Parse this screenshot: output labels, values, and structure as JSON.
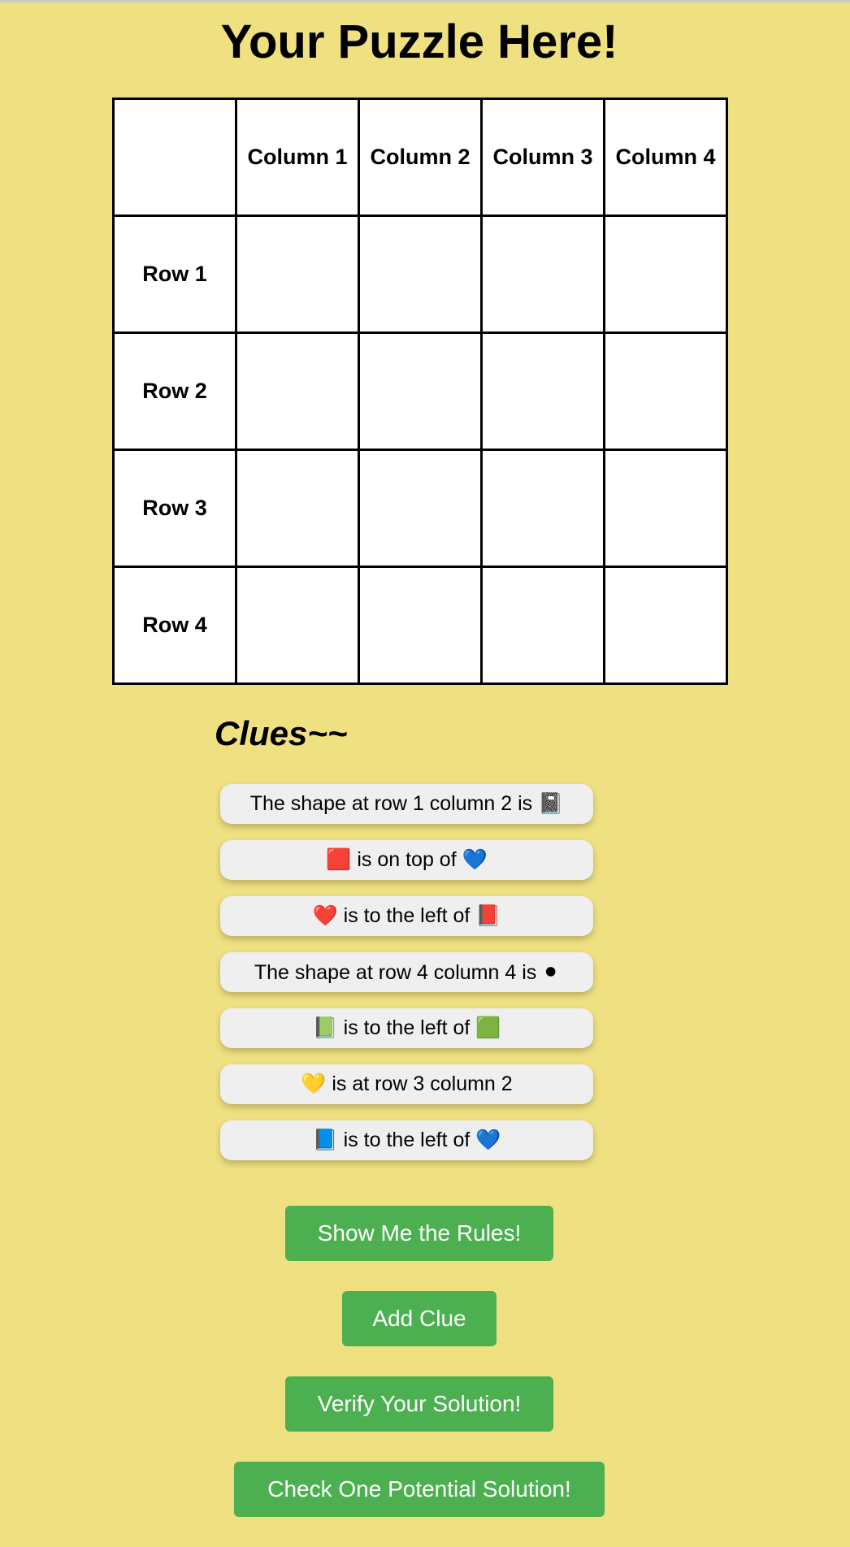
{
  "page": {
    "title": "Your Puzzle Here!"
  },
  "grid": {
    "corner": "",
    "columns": [
      "Column 1",
      "Column 2",
      "Column 3",
      "Column 4"
    ],
    "rows": [
      "Row 1",
      "Row 2",
      "Row 3",
      "Row 4"
    ]
  },
  "clues": {
    "heading": "Clues~~",
    "items": [
      "The shape at row 1 column 2 is 📓",
      "🟥 is on top of 💙",
      "❤️ is to the left of 📕",
      "The shape at row 4 column 4 is ⚫",
      "📗 is to the left of 🟩",
      "💛 is at row 3 column 2",
      "📘 is to the left of 💙"
    ]
  },
  "buttons": {
    "rules": "Show Me the Rules!",
    "add_clue": "Add Clue",
    "verify": "Verify Your Solution!",
    "check_one": "Check One Potential Solution!"
  },
  "colors": {
    "background": "#efe081",
    "button": "#4cb050",
    "clue_bg": "#efefef"
  }
}
